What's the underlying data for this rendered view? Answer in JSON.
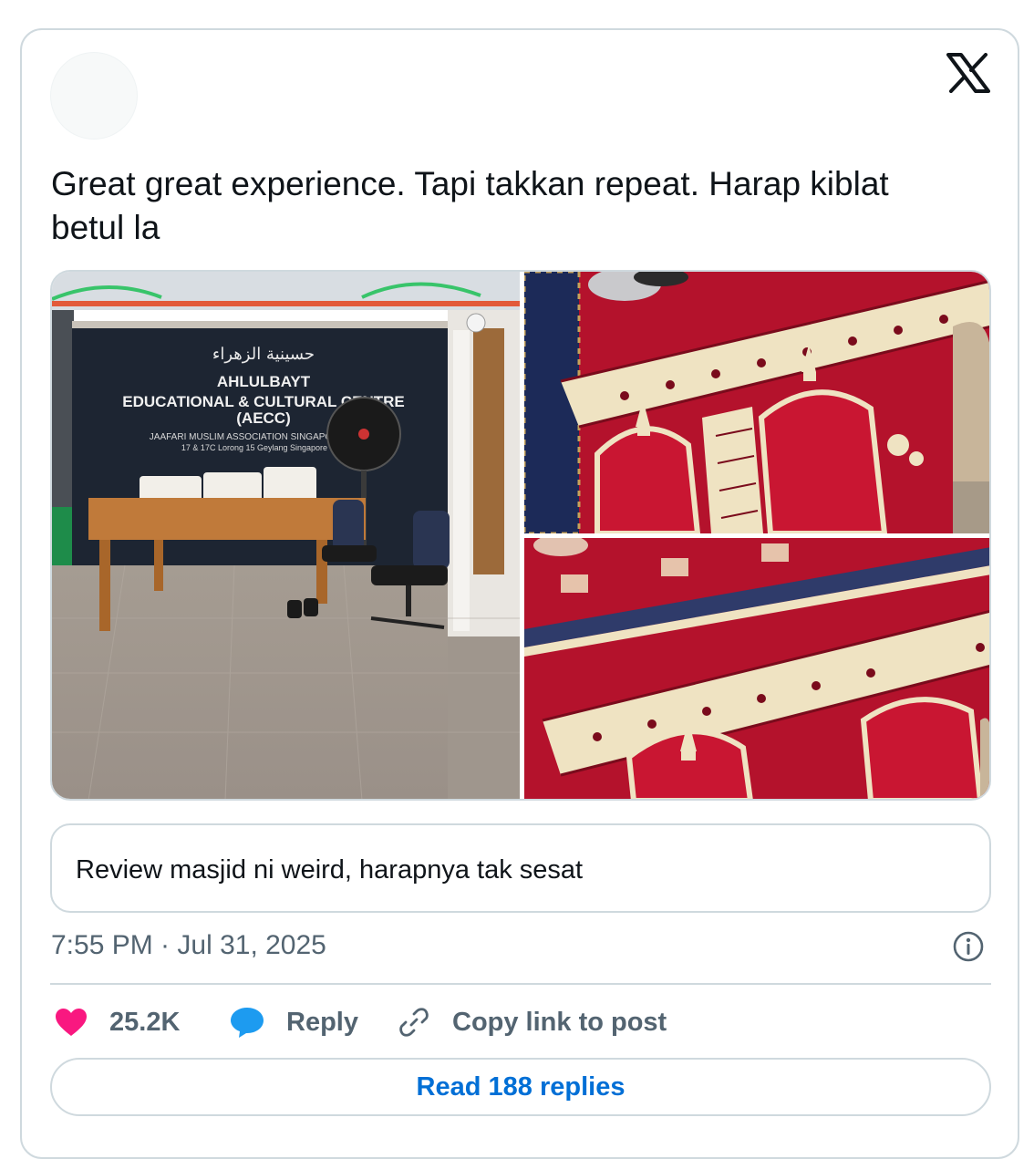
{
  "tweet": {
    "text": "Great great experience. Tapi takkan repeat. Harap kiblat betul la",
    "timestamp": "7:55 PM · Jul 31, 2025"
  },
  "photos": {
    "left": {
      "sign_arabic": "حسينية الزهراء",
      "sign_line1": "AHLULBAYT",
      "sign_line2": "EDUCATIONAL & CULTURAL CENTRE",
      "sign_line3": "(AECC)",
      "sign_line4": "JAAFARI MUSLIM ASSOCIATION SINGAPORE (JMAS)",
      "sign_line5": "17 & 17C Lorong 15 Geylang Singapore 38..."
    }
  },
  "quote": {
    "text": "Review masjid ni weird, harapnya tak sesat"
  },
  "actions": {
    "like_count": "25.2K",
    "reply_label": "Reply",
    "copy_label": "Copy link to post"
  },
  "read_replies_label": "Read 188 replies",
  "colors": {
    "like": "#f91880",
    "reply": "#1d9bf0",
    "link": "#006fd6",
    "border": "#cfd9de",
    "secondary_text": "#536471"
  }
}
